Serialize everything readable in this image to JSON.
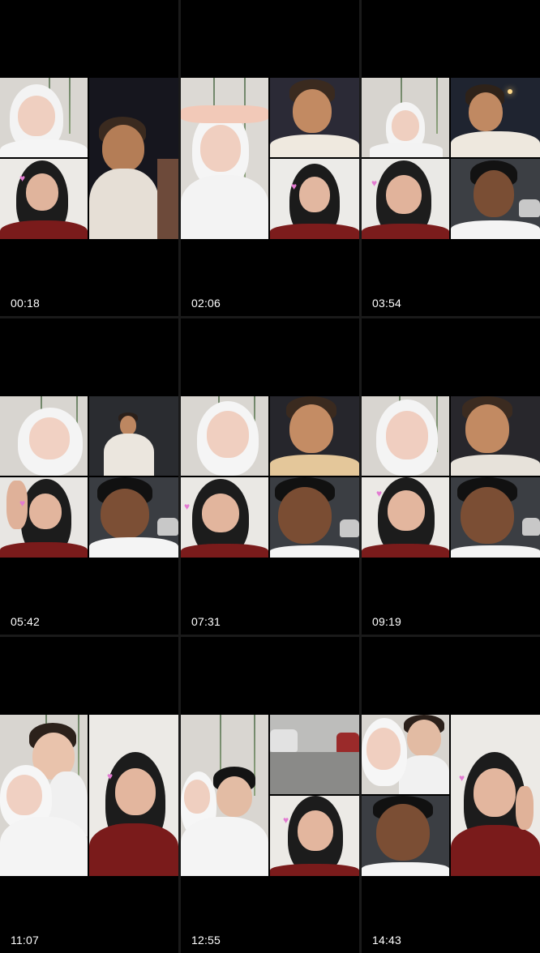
{
  "gallery": {
    "thumbnails": [
      {
        "timestamp": "00:18"
      },
      {
        "timestamp": "02:06"
      },
      {
        "timestamp": "03:54"
      },
      {
        "timestamp": "05:42"
      },
      {
        "timestamp": "07:31"
      },
      {
        "timestamp": "09:19"
      },
      {
        "timestamp": "11:07"
      },
      {
        "timestamp": "12:55"
      },
      {
        "timestamp": "14:43"
      }
    ]
  },
  "colors": {
    "background": "#000000",
    "separator": "#1a1a1a",
    "timestamp_text": "#ffffff",
    "heart_sticker": "#e37bd2"
  }
}
